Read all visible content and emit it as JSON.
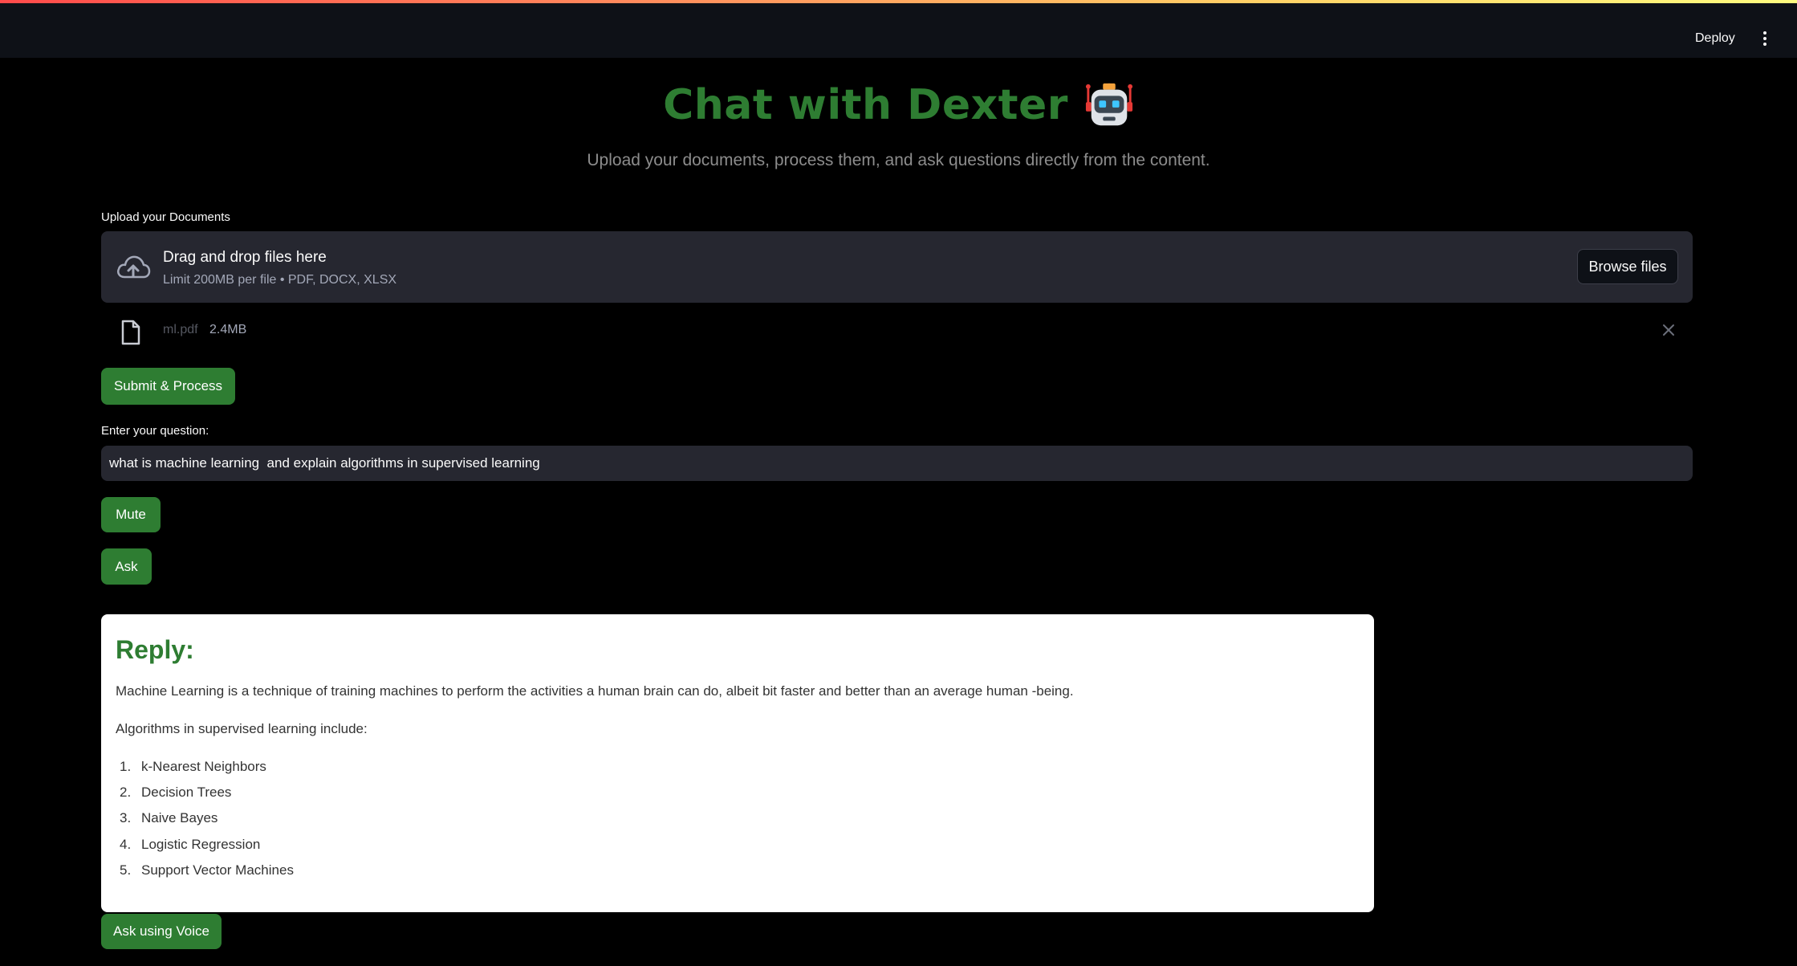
{
  "header": {
    "deploy_label": "Deploy",
    "menu_icon": "kebab-menu-icon"
  },
  "hero": {
    "title": "Chat with Dexter",
    "title_icon": "robot-icon",
    "subtitle": "Upload your documents, process them, and ask questions directly from the content."
  },
  "upload": {
    "label": "Upload your Documents",
    "drop_title": "Drag and drop files here",
    "drop_limit": "Limit 200MB per file • PDF, DOCX, XLSX",
    "browse_label": "Browse files",
    "file": {
      "name": "ml.pdf",
      "size": "2.4MB"
    }
  },
  "actions": {
    "submit_label": "Submit & Process",
    "question_label": "Enter your question:",
    "question_value": "what is machine learning  and explain algorithms in supervised learning",
    "mute_label": "Mute",
    "ask_label": "Ask",
    "voice_label": "Ask using Voice"
  },
  "reply": {
    "title": "Reply:",
    "paragraph1": "Machine Learning is a technique of training machines to perform the activities a human brain can do, albeit bit faster and better than an average human -being.",
    "paragraph2": "Algorithms in supervised learning include:",
    "items": [
      {
        "num": "1.",
        "text": "k-Nearest Neighbors"
      },
      {
        "num": "2.",
        "text": "Decision Trees"
      },
      {
        "num": "3.",
        "text": "Naive Bayes"
      },
      {
        "num": "4.",
        "text": "Logistic Regression"
      },
      {
        "num": "5.",
        "text": "Support Vector Machines"
      }
    ]
  },
  "colors": {
    "accent": "#2e7d32",
    "background": "#000000",
    "header": "#0e1117",
    "widget": "#262730"
  }
}
